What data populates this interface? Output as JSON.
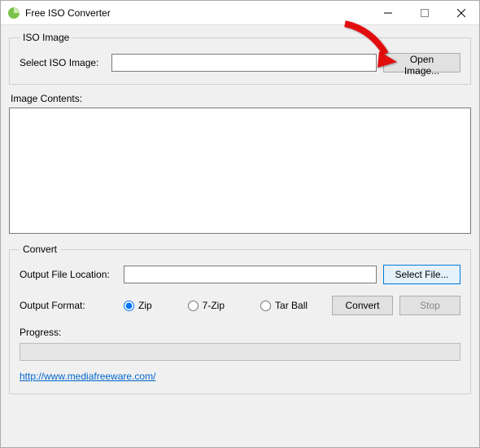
{
  "window": {
    "title": "Free ISO Converter"
  },
  "iso": {
    "legend": "ISO Image",
    "selectLabel": "Select ISO Image:",
    "selectValue": "",
    "openButton": "Open Image..."
  },
  "contents": {
    "label": "Image Contents:"
  },
  "convert": {
    "legend": "Convert",
    "outputLocationLabel": "Output File Location:",
    "outputLocationValue": "",
    "selectFileButton": "Select File...",
    "outputFormatLabel": "Output Format:",
    "formats": {
      "zip": "Zip",
      "sevenZip": "7-Zip",
      "tarball": "Tar Ball"
    },
    "selectedFormat": "zip",
    "convertButton": "Convert",
    "stopButton": "Stop",
    "progressLabel": "Progress:"
  },
  "footer": {
    "linkText": "http://www.mediafreeware.com/",
    "linkHref": "http://www.mediafreeware.com/"
  }
}
